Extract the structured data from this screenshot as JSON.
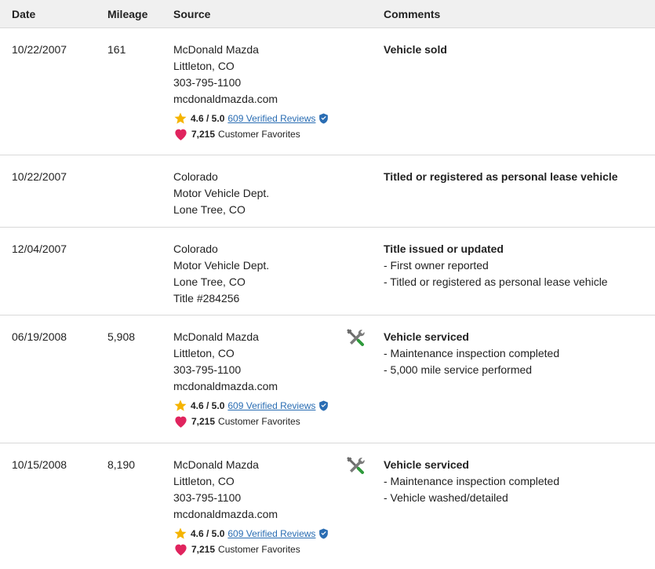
{
  "columns": {
    "date": "Date",
    "mileage": "Mileage",
    "source": "Source",
    "comments": "Comments"
  },
  "colors": {
    "header_bg": "#f0f0f0",
    "link": "#2a6db3",
    "star": "#f5b400",
    "heart": "#e0245e",
    "verified": "#2a6db3",
    "divider": "#d9d9d9"
  },
  "rows": [
    {
      "date": "10/22/2007",
      "mileage": "161",
      "source": [
        "McDonald Mazda",
        "Littleton, CO",
        "303-795-1100",
        "mcdonaldmazda.com"
      ],
      "has_dealer_rating": true,
      "rating": "4.6 / 5.0",
      "reviews": "609 Verified Reviews",
      "favorites": "7,215",
      "favorites_label": "Customer Favorites",
      "icon": "",
      "comment_title": "Vehicle sold",
      "comment_items": []
    },
    {
      "date": "10/22/2007",
      "mileage": "",
      "source": [
        "Colorado",
        "Motor Vehicle Dept.",
        "Lone Tree, CO"
      ],
      "has_dealer_rating": false,
      "icon": "",
      "comment_title": "Titled or registered as personal lease vehicle",
      "comment_items": []
    },
    {
      "date": "12/04/2007",
      "mileage": "",
      "source": [
        "Colorado",
        "Motor Vehicle Dept.",
        "Lone Tree, CO",
        "Title #284256"
      ],
      "has_dealer_rating": false,
      "icon": "",
      "comment_title": "Title issued or updated",
      "comment_items": [
        "- First owner reported",
        "- Titled or registered as personal lease vehicle"
      ]
    },
    {
      "date": "06/19/2008",
      "mileage": "5,908",
      "source": [
        "McDonald Mazda",
        "Littleton, CO",
        "303-795-1100",
        "mcdonaldmazda.com"
      ],
      "has_dealer_rating": true,
      "rating": "4.6 / 5.0",
      "reviews": "609 Verified Reviews",
      "favorites": "7,215",
      "favorites_label": "Customer Favorites",
      "icon": "service-tools-icon",
      "comment_title": "Vehicle serviced",
      "comment_items": [
        "- Maintenance inspection completed",
        "- 5,000 mile service performed"
      ]
    },
    {
      "date": "10/15/2008",
      "mileage": "8,190",
      "source": [
        "McDonald Mazda",
        "Littleton, CO",
        "303-795-1100",
        "mcdonaldmazda.com"
      ],
      "has_dealer_rating": true,
      "rating": "4.6 / 5.0",
      "reviews": "609 Verified Reviews",
      "favorites": "7,215",
      "favorites_label": "Customer Favorites",
      "icon": "service-tools-icon",
      "comment_title": "Vehicle serviced",
      "comment_items": [
        "- Maintenance inspection completed",
        "- Vehicle washed/detailed"
      ]
    }
  ]
}
